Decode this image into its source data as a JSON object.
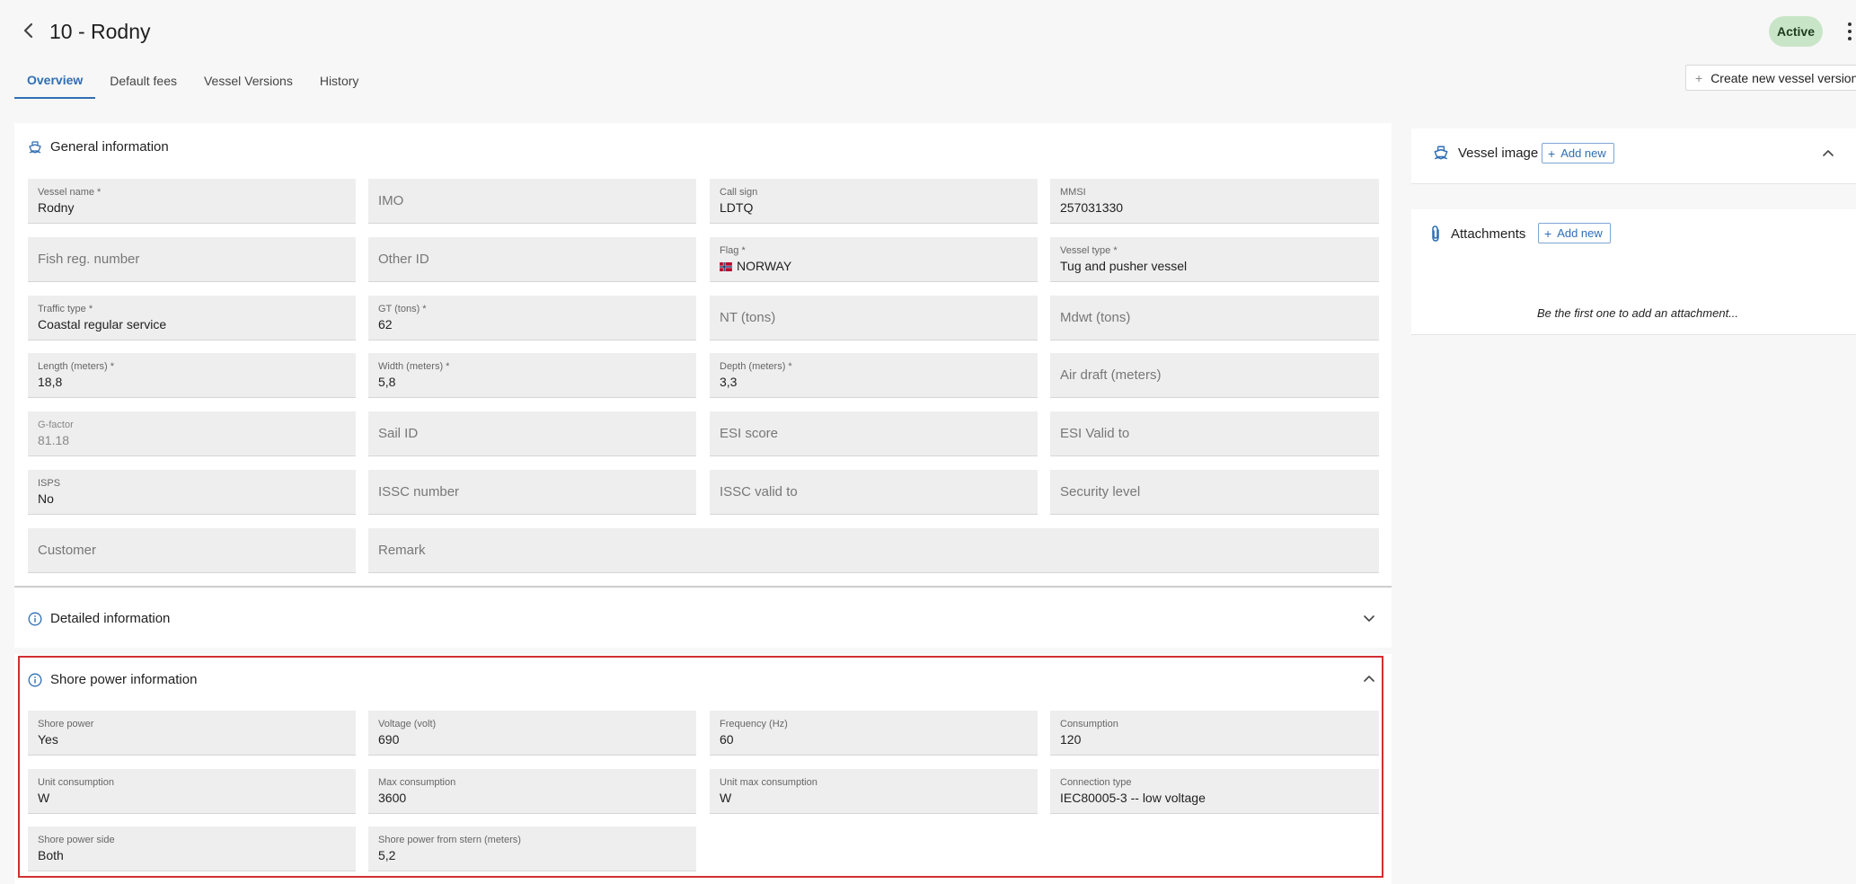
{
  "header": {
    "title": "10 - Rodny",
    "status": "Active"
  },
  "tabs": [
    "Overview",
    "Default fees",
    "Vessel Versions",
    "History"
  ],
  "actions": {
    "create_version": "Create new vessel version"
  },
  "general": {
    "title": "General information",
    "fields": {
      "vessel_name": {
        "label": "Vessel name *",
        "value": "Rodny"
      },
      "imo": {
        "placeholder": "IMO"
      },
      "call_sign": {
        "label": "Call sign",
        "value": "LDTQ"
      },
      "mmsi": {
        "label": "MMSI",
        "value": "257031330"
      },
      "fish_reg": {
        "placeholder": "Fish reg. number"
      },
      "other_id": {
        "placeholder": "Other ID"
      },
      "flag": {
        "label": "Flag *",
        "value": "NORWAY"
      },
      "vessel_type": {
        "label": "Vessel type *",
        "value": "Tug and pusher vessel"
      },
      "traffic_type": {
        "label": "Traffic type *",
        "value": "Coastal regular service"
      },
      "gt": {
        "label": "GT (tons) *",
        "value": "62"
      },
      "nt": {
        "placeholder": "NT (tons)"
      },
      "mdwt": {
        "placeholder": "Mdwt (tons)"
      },
      "length": {
        "label": "Length (meters) *",
        "value": "18,8"
      },
      "width": {
        "label": "Width (meters) *",
        "value": "5,8"
      },
      "depth": {
        "label": "Depth (meters) *",
        "value": "3,3"
      },
      "air_draft": {
        "placeholder": "Air draft (meters)"
      },
      "g_factor": {
        "label": "G-factor",
        "value": "81.18"
      },
      "sail_id": {
        "placeholder": "Sail ID"
      },
      "esi_score": {
        "placeholder": "ESI score"
      },
      "esi_valid": {
        "placeholder": "ESI Valid to"
      },
      "isps": {
        "label": "ISPS",
        "value": "No"
      },
      "issc_number": {
        "placeholder": "ISSC number"
      },
      "issc_valid": {
        "placeholder": "ISSC valid to"
      },
      "security_level": {
        "placeholder": "Security level"
      },
      "customer": {
        "placeholder": "Customer"
      },
      "remark": {
        "placeholder": "Remark"
      }
    }
  },
  "detailed": {
    "title": "Detailed information"
  },
  "shore": {
    "title": "Shore power information",
    "fields": {
      "shore_power": {
        "label": "Shore power",
        "value": "Yes"
      },
      "voltage": {
        "label": "Voltage (volt)",
        "value": "690"
      },
      "frequency": {
        "label": "Frequency (Hz)",
        "value": "60"
      },
      "consumption": {
        "label": "Consumption",
        "value": "120"
      },
      "unit_consumption": {
        "label": "Unit consumption",
        "value": "W"
      },
      "max_consumption": {
        "label": "Max consumption",
        "value": "3600"
      },
      "unit_max_consumption": {
        "label": "Unit max consumption",
        "value": "W"
      },
      "connection_type": {
        "label": "Connection type",
        "value": "IEC80005-3 -- low voltage"
      },
      "shore_side": {
        "label": "Shore power side",
        "value": "Both"
      },
      "from_stern": {
        "label": "Shore power from stern (meters)",
        "value": "5,2"
      }
    }
  },
  "sidebar": {
    "vessel_image": {
      "title": "Vessel image",
      "add_label": "Add new"
    },
    "attachments": {
      "title": "Attachments",
      "add_label": "Add new",
      "empty_text": "Be the first one to add an attachment..."
    }
  },
  "colors": {
    "accent": "#2f6fb3",
    "status_bg": "#c9e5c8",
    "highlight": "#d32f2f"
  },
  "icons": [
    "back-arrow-icon",
    "kebab-menu-icon",
    "ship-icon",
    "info-icon",
    "chevron-down-icon",
    "chevron-up-icon",
    "paperclip-icon",
    "plus-icon",
    "norway-flag-icon"
  ]
}
